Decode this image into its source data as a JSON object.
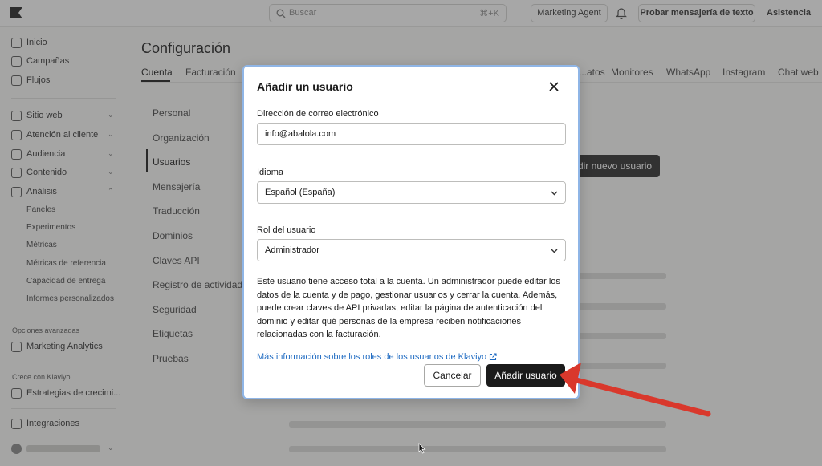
{
  "topbar": {
    "search_placeholder": "Buscar",
    "search_shortcut": "⌘+K",
    "agent_label": "Marketing Agent",
    "test_label": "Probar mensajería de texto",
    "help_label": "Asistencia"
  },
  "sidebar": {
    "items": [
      {
        "label": "Inicio"
      },
      {
        "label": "Campañas"
      },
      {
        "label": "Flujos"
      },
      {
        "label": "Sitio web"
      },
      {
        "label": "Atención al cliente"
      },
      {
        "label": "Audiencia"
      },
      {
        "label": "Contenido"
      },
      {
        "label": "Análisis"
      }
    ],
    "analytics_sub": [
      "Paneles",
      "Experimentos",
      "Métricas",
      "Métricas de referencia",
      "Capacidad de entrega",
      "Informes personalizados"
    ],
    "advanced_title": "Opciones avanzadas",
    "advanced_item": "Marketing Analytics",
    "grow_title": "Crece con Klaviyo",
    "grow_item": "Estrategias de crecimi...",
    "integrations": "Integraciones"
  },
  "main": {
    "title": "Configuración",
    "tabs": [
      "Cuenta",
      "Facturación",
      "...atos",
      "Monitores",
      "WhatsApp",
      "Instagram",
      "Chat web"
    ],
    "side_items": [
      "Personal",
      "Organización",
      "Usuarios",
      "Mensajería",
      "Traducción",
      "Dominios",
      "Claves API",
      "Registro de actividad",
      "Seguridad",
      "Etiquetas",
      "Pruebas"
    ],
    "new_user_button": "...dir nuevo usuario"
  },
  "modal": {
    "title": "Añadir un usuario",
    "email_label": "Dirección de correo electrónico",
    "email_value": "info@abalola.com",
    "language_label": "Idioma",
    "language_value": "Español (España)",
    "role_label": "Rol del usuario",
    "role_value": "Administrador",
    "description": "Este usuario tiene acceso total a la cuenta. Un administrador puede editar los datos de la cuenta y de pago, gestionar usuarios y cerrar la cuenta. Además, puede crear claves de API privadas, editar la página de autenticación del dominio y editar qué personas de la empresa reciben notificaciones relacionadas con la facturación.",
    "link_text": "Más información sobre los roles de los usuarios de Klaviyo",
    "cancel_label": "Cancelar",
    "add_label": "Añadir usuario"
  },
  "colors": {
    "accent_link": "#1f6bc2",
    "primary_button": "#1b1b1b",
    "annotation_arrow": "#d9382c",
    "modal_border": "#8fb5e6"
  }
}
